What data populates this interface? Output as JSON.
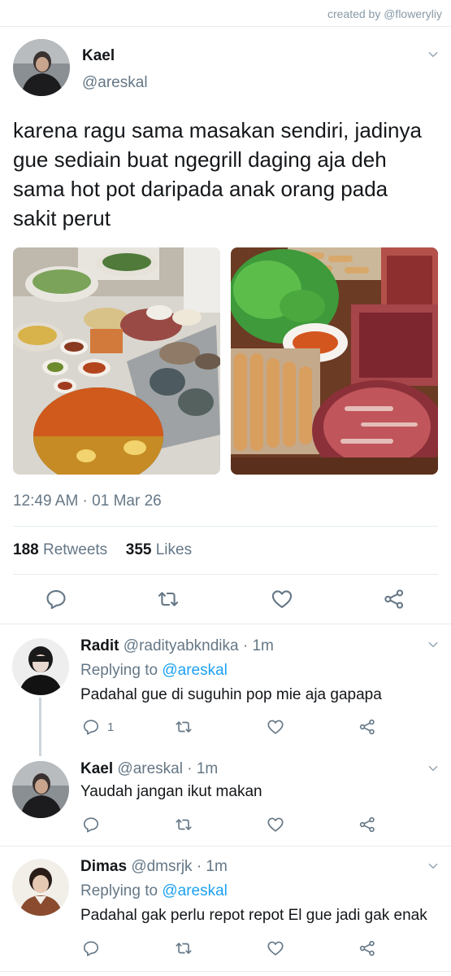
{
  "credit": "created by @floweryliy",
  "tweet": {
    "name": "Kael",
    "handle": "@areskal",
    "text": "karena ragu sama masakan sendiri, jadinya gue sediain buat ngegrill daging aja deh sama hot pot daripada anak orang pada sakit perut",
    "timestamp": "12:49 AM · 01 Mar 26",
    "retweets_count": "188",
    "retweets_label": "Retweets",
    "likes_count": "355",
    "likes_label": "Likes"
  },
  "replies": [
    {
      "name": "Radit",
      "handle": "@radityabkndika · 1m",
      "replying_prefix": "Replying to",
      "replying_to": "@areskal",
      "text": "Padahal gue di suguhin pop mie aja gapapa",
      "reply_count": "1"
    },
    {
      "name": "Kael",
      "handle": "@areskal · 1m",
      "text": "Yaudah jangan ikut makan"
    },
    {
      "name": "Dimas",
      "handle": "@dmsrjk · 1m",
      "replying_prefix": "Replying to",
      "replying_to": "@areskal",
      "text": "Padahal gak perlu repot repot El gue jadi gak enak"
    }
  ],
  "icons": [
    "chevron-down-icon",
    "reply-icon",
    "retweet-icon",
    "like-icon",
    "share-icon"
  ],
  "colors": {
    "accent": "#1da1f2",
    "secondary_text": "#657786",
    "divider": "#e6ecf0"
  }
}
